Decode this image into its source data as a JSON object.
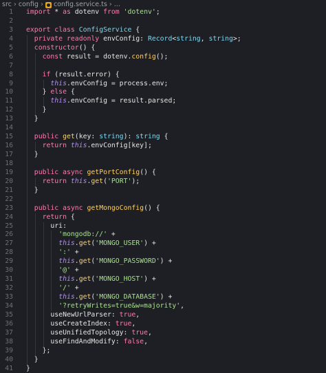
{
  "breadcrumb": {
    "items": [
      "src",
      "config",
      "config.service.ts",
      "..."
    ],
    "file_icon": "typescript-file-icon"
  },
  "lines": [
    {
      "n": "1",
      "tokens": [
        [
          "kw",
          "import"
        ],
        [
          "txt",
          " * "
        ],
        [
          "kw",
          "as"
        ],
        [
          "txt",
          " dotenv "
        ],
        [
          "kw",
          "from"
        ],
        [
          "txt",
          " "
        ],
        [
          "str",
          "'dotenv'"
        ],
        [
          "txt",
          ";"
        ]
      ]
    },
    {
      "n": "2",
      "tokens": []
    },
    {
      "n": "3",
      "tokens": [
        [
          "kw",
          "export"
        ],
        [
          "txt",
          " "
        ],
        [
          "kw",
          "class"
        ],
        [
          "txt",
          " "
        ],
        [
          "cls",
          "ConfigService"
        ],
        [
          "txt",
          " {"
        ]
      ]
    },
    {
      "n": "4",
      "tokens": [
        [
          "txt",
          "  "
        ],
        [
          "kw",
          "private"
        ],
        [
          "txt",
          " "
        ],
        [
          "kw",
          "readonly"
        ],
        [
          "txt",
          " envConfig: "
        ],
        [
          "cls",
          "Record"
        ],
        [
          "txt",
          "<"
        ],
        [
          "cls",
          "string"
        ],
        [
          "txt",
          ", "
        ],
        [
          "cls",
          "string"
        ],
        [
          "txt",
          ">;"
        ]
      ]
    },
    {
      "n": "5",
      "tokens": [
        [
          "txt",
          "  "
        ],
        [
          "kw",
          "constructor"
        ],
        [
          "txt",
          "() {"
        ]
      ]
    },
    {
      "n": "6",
      "tokens": [
        [
          "txt",
          "    "
        ],
        [
          "kw",
          "const"
        ],
        [
          "txt",
          " result = dotenv."
        ],
        [
          "fn",
          "config"
        ],
        [
          "txt",
          "();"
        ]
      ]
    },
    {
      "n": "7",
      "tokens": []
    },
    {
      "n": "8",
      "tokens": [
        [
          "txt",
          "    "
        ],
        [
          "kw",
          "if"
        ],
        [
          "txt",
          " (result.error) {"
        ]
      ]
    },
    {
      "n": "9",
      "tokens": [
        [
          "txt",
          "      "
        ],
        [
          "this",
          "this"
        ],
        [
          "txt",
          ".envConfig = process.env;"
        ]
      ]
    },
    {
      "n": "10",
      "tokens": [
        [
          "txt",
          "    } "
        ],
        [
          "kw",
          "else"
        ],
        [
          "txt",
          " {"
        ]
      ]
    },
    {
      "n": "11",
      "tokens": [
        [
          "txt",
          "      "
        ],
        [
          "this",
          "this"
        ],
        [
          "txt",
          ".envConfig = result.parsed;"
        ]
      ]
    },
    {
      "n": "12",
      "tokens": [
        [
          "txt",
          "    }"
        ]
      ]
    },
    {
      "n": "13",
      "tokens": [
        [
          "txt",
          "  }"
        ]
      ]
    },
    {
      "n": "14",
      "tokens": []
    },
    {
      "n": "15",
      "tokens": [
        [
          "txt",
          "  "
        ],
        [
          "kw",
          "public"
        ],
        [
          "txt",
          " "
        ],
        [
          "fn",
          "get"
        ],
        [
          "txt",
          "(key: "
        ],
        [
          "cls",
          "string"
        ],
        [
          "txt",
          "): "
        ],
        [
          "cls",
          "string"
        ],
        [
          "txt",
          " {"
        ]
      ]
    },
    {
      "n": "16",
      "tokens": [
        [
          "txt",
          "    "
        ],
        [
          "kw",
          "return"
        ],
        [
          "txt",
          " "
        ],
        [
          "this",
          "this"
        ],
        [
          "txt",
          ".envConfig[key];"
        ]
      ]
    },
    {
      "n": "17",
      "tokens": [
        [
          "txt",
          "  }"
        ]
      ]
    },
    {
      "n": "18",
      "tokens": []
    },
    {
      "n": "19",
      "tokens": [
        [
          "txt",
          "  "
        ],
        [
          "kw",
          "public"
        ],
        [
          "txt",
          " "
        ],
        [
          "kw",
          "async"
        ],
        [
          "txt",
          " "
        ],
        [
          "fn",
          "getPortConfig"
        ],
        [
          "txt",
          "() {"
        ]
      ]
    },
    {
      "n": "20",
      "tokens": [
        [
          "txt",
          "    "
        ],
        [
          "kw",
          "return"
        ],
        [
          "txt",
          " "
        ],
        [
          "this",
          "this"
        ],
        [
          "txt",
          "."
        ],
        [
          "fn",
          "get"
        ],
        [
          "txt",
          "("
        ],
        [
          "str",
          "'PORT'"
        ],
        [
          "txt",
          ");"
        ]
      ]
    },
    {
      "n": "21",
      "tokens": [
        [
          "txt",
          "  }"
        ]
      ]
    },
    {
      "n": "22",
      "tokens": []
    },
    {
      "n": "23",
      "tokens": [
        [
          "txt",
          "  "
        ],
        [
          "kw",
          "public"
        ],
        [
          "txt",
          " "
        ],
        [
          "kw",
          "async"
        ],
        [
          "txt",
          " "
        ],
        [
          "fn",
          "getMongoConfig"
        ],
        [
          "txt",
          "() {"
        ]
      ]
    },
    {
      "n": "24",
      "tokens": [
        [
          "txt",
          "    "
        ],
        [
          "kw",
          "return"
        ],
        [
          "txt",
          " {"
        ]
      ]
    },
    {
      "n": "25",
      "tokens": [
        [
          "txt",
          "      uri:"
        ]
      ]
    },
    {
      "n": "26",
      "tokens": [
        [
          "txt",
          "        "
        ],
        [
          "str",
          "'mongodb://'"
        ],
        [
          "txt",
          " +"
        ]
      ]
    },
    {
      "n": "27",
      "tokens": [
        [
          "txt",
          "        "
        ],
        [
          "this",
          "this"
        ],
        [
          "txt",
          "."
        ],
        [
          "fn",
          "get"
        ],
        [
          "txt",
          "("
        ],
        [
          "str",
          "'MONGO_USER'"
        ],
        [
          "txt",
          ") +"
        ]
      ]
    },
    {
      "n": "28",
      "tokens": [
        [
          "txt",
          "        "
        ],
        [
          "str",
          "':'"
        ],
        [
          "txt",
          " +"
        ]
      ]
    },
    {
      "n": "29",
      "tokens": [
        [
          "txt",
          "        "
        ],
        [
          "this",
          "this"
        ],
        [
          "txt",
          "."
        ],
        [
          "fn",
          "get"
        ],
        [
          "txt",
          "("
        ],
        [
          "str",
          "'MONGO_PASSWORD'"
        ],
        [
          "txt",
          ") +"
        ]
      ]
    },
    {
      "n": "30",
      "tokens": [
        [
          "txt",
          "        "
        ],
        [
          "str",
          "'@'"
        ],
        [
          "txt",
          " +"
        ]
      ]
    },
    {
      "n": "31",
      "tokens": [
        [
          "txt",
          "        "
        ],
        [
          "this",
          "this"
        ],
        [
          "txt",
          "."
        ],
        [
          "fn",
          "get"
        ],
        [
          "txt",
          "("
        ],
        [
          "str",
          "'MONGO_HOST'"
        ],
        [
          "txt",
          ") +"
        ]
      ]
    },
    {
      "n": "32",
      "tokens": [
        [
          "txt",
          "        "
        ],
        [
          "str",
          "'/'"
        ],
        [
          "txt",
          " +"
        ]
      ]
    },
    {
      "n": "33",
      "tokens": [
        [
          "txt",
          "        "
        ],
        [
          "this",
          "this"
        ],
        [
          "txt",
          "."
        ],
        [
          "fn",
          "get"
        ],
        [
          "txt",
          "("
        ],
        [
          "str",
          "'MONGO_DATABASE'"
        ],
        [
          "txt",
          ") +"
        ]
      ]
    },
    {
      "n": "34",
      "tokens": [
        [
          "txt",
          "        "
        ],
        [
          "str",
          "'?retryWrites=true&w=majority'"
        ],
        [
          "txt",
          ","
        ]
      ]
    },
    {
      "n": "35",
      "tokens": [
        [
          "txt",
          "      useNewUrlParser: "
        ],
        [
          "kw",
          "true"
        ],
        [
          "txt",
          ","
        ]
      ]
    },
    {
      "n": "36",
      "tokens": [
        [
          "txt",
          "      useCreateIndex: "
        ],
        [
          "kw",
          "true"
        ],
        [
          "txt",
          ","
        ]
      ]
    },
    {
      "n": "37",
      "tokens": [
        [
          "txt",
          "      useUnifiedTopology: "
        ],
        [
          "kw",
          "true"
        ],
        [
          "txt",
          ","
        ]
      ]
    },
    {
      "n": "38",
      "tokens": [
        [
          "txt",
          "      useFindAndModify: "
        ],
        [
          "kw",
          "false"
        ],
        [
          "txt",
          ","
        ]
      ]
    },
    {
      "n": "39",
      "tokens": [
        [
          "txt",
          "    };"
        ]
      ]
    },
    {
      "n": "40",
      "tokens": [
        [
          "txt",
          "  }"
        ]
      ]
    },
    {
      "n": "41",
      "tokens": [
        [
          "txt",
          "}"
        ]
      ]
    }
  ]
}
